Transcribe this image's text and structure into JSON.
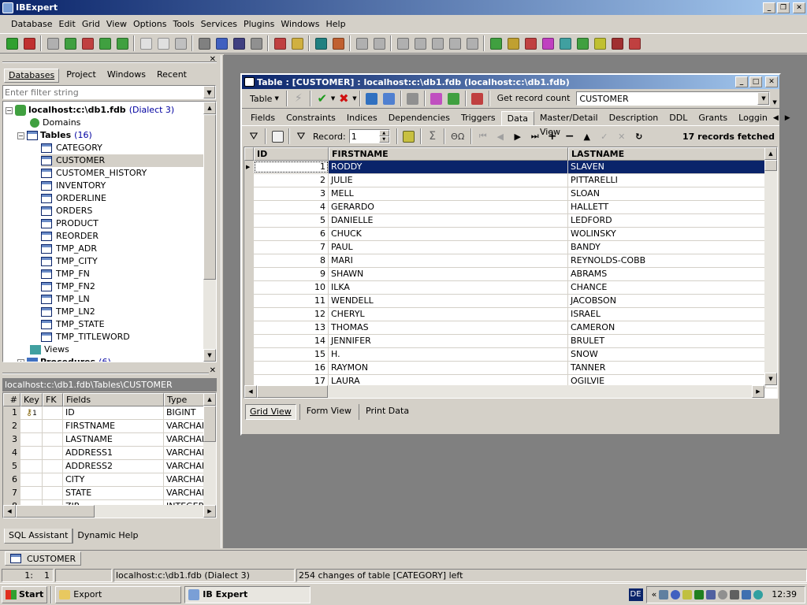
{
  "app": {
    "title": "IBExpert"
  },
  "menu": [
    "Database",
    "Edit",
    "Grid",
    "View",
    "Options",
    "Tools",
    "Services",
    "Plugins",
    "Windows",
    "Help"
  ],
  "left_panel": {
    "tabs": [
      "Databases",
      "Project",
      "Windows",
      "Recent"
    ],
    "filter_placeholder": "Enter filter string",
    "db_node": "localhost:c:\\db1.fdb",
    "db_dialect": "(Dialect 3)",
    "domains": "Domains",
    "tables_label": "Tables",
    "tables_count": "(16)",
    "tables": [
      "CATEGORY",
      "CUSTOMER",
      "CUSTOMER_HISTORY",
      "INVENTORY",
      "ORDERLINE",
      "ORDERS",
      "PRODUCT",
      "REORDER",
      "TMP_ADR",
      "TMP_CITY",
      "TMP_FN",
      "TMP_FN2",
      "TMP_LN",
      "TMP_LN2",
      "TMP_STATE",
      "TMP_TITLEWORD"
    ],
    "views": "Views",
    "procedures": "Procedures",
    "procedures_count": "(6)"
  },
  "fields_panel": {
    "path": "localhost:c:\\db1.fdb\\Tables\\CUSTOMER",
    "headers": [
      "#",
      "Key",
      "FK",
      "Fields",
      "Type"
    ],
    "rows": [
      {
        "n": "1",
        "key": "1",
        "fk": "",
        "field": "ID",
        "type": "BIGINT"
      },
      {
        "n": "2",
        "key": "",
        "fk": "",
        "field": "FIRSTNAME",
        "type": "VARCHAR"
      },
      {
        "n": "3",
        "key": "",
        "fk": "",
        "field": "LASTNAME",
        "type": "VARCHAR"
      },
      {
        "n": "4",
        "key": "",
        "fk": "",
        "field": "ADDRESS1",
        "type": "VARCHAR"
      },
      {
        "n": "5",
        "key": "",
        "fk": "",
        "field": "ADDRESS2",
        "type": "VARCHAR"
      },
      {
        "n": "6",
        "key": "",
        "fk": "",
        "field": "CITY",
        "type": "VARCHAR"
      },
      {
        "n": "7",
        "key": "",
        "fk": "",
        "field": "STATE",
        "type": "VARCHAR"
      },
      {
        "n": "8",
        "key": "",
        "fk": "",
        "field": "ZIP",
        "type": "INTEGER"
      }
    ],
    "bottom_tabs": [
      "SQL Assistant",
      "Dynamic Help"
    ]
  },
  "table_window": {
    "title": "Table : [CUSTOMER] : localhost:c:\\db1.fdb (localhost:c:\\db1.fdb)",
    "table_menu": "Table",
    "get_record_count": "Get record count",
    "table_select": "CUSTOMER",
    "tabs": [
      "Fields",
      "Constraints",
      "Indices",
      "Dependencies",
      "Triggers",
      "Data",
      "Master/Detail View",
      "Description",
      "DDL",
      "Grants",
      "Loggin"
    ],
    "record_label": "Record:",
    "record_value": "1",
    "records_fetched": "17 records fetched",
    "columns": [
      "ID",
      "FIRSTNAME",
      "LASTNAME"
    ],
    "rows": [
      {
        "id": "1",
        "first": "RODDY",
        "last": "SLAVEN"
      },
      {
        "id": "2",
        "first": "JULIE",
        "last": "PITTARELLI"
      },
      {
        "id": "3",
        "first": "MELL",
        "last": "SLOAN"
      },
      {
        "id": "4",
        "first": "GERARDO",
        "last": "HALLETT"
      },
      {
        "id": "5",
        "first": "DANIELLE",
        "last": "LEDFORD"
      },
      {
        "id": "6",
        "first": "CHUCK",
        "last": "WOLINSKY"
      },
      {
        "id": "7",
        "first": "PAUL",
        "last": "BANDY"
      },
      {
        "id": "8",
        "first": "MARI",
        "last": "REYNOLDS-COBB"
      },
      {
        "id": "9",
        "first": "SHAWN",
        "last": "ABRAMS"
      },
      {
        "id": "10",
        "first": "ILKA",
        "last": "CHANCE"
      },
      {
        "id": "11",
        "first": "WENDELL",
        "last": "JACOBSON"
      },
      {
        "id": "12",
        "first": "CHERYL",
        "last": "ISRAEL"
      },
      {
        "id": "13",
        "first": "THOMAS",
        "last": "CAMERON"
      },
      {
        "id": "14",
        "first": "JENNIFER",
        "last": "BRULET"
      },
      {
        "id": "15",
        "first": "H.",
        "last": "SNOW"
      },
      {
        "id": "16",
        "first": "RAYMON",
        "last": "TANNER"
      },
      {
        "id": "17",
        "first": "LAURA",
        "last": "OGILVIE"
      }
    ],
    "view_tabs": [
      "Grid View",
      "Form View",
      "Print Data"
    ]
  },
  "window_tab": "CUSTOMER",
  "status": {
    "pos": "1:",
    "col": "1",
    "db": "localhost:c:\\db1.fdb (Dialect 3)",
    "msg": "254 changes of table [CATEGORY] left"
  },
  "taskbar": {
    "start": "Start",
    "items": [
      "Export",
      "IB Expert"
    ],
    "lang": "DE",
    "chevron": "«",
    "clock": "12:39"
  },
  "colors": {
    "title_active": "#0a246a",
    "selection": "#0a246a",
    "face": "#d4d0c8",
    "link": "#0000a0"
  }
}
